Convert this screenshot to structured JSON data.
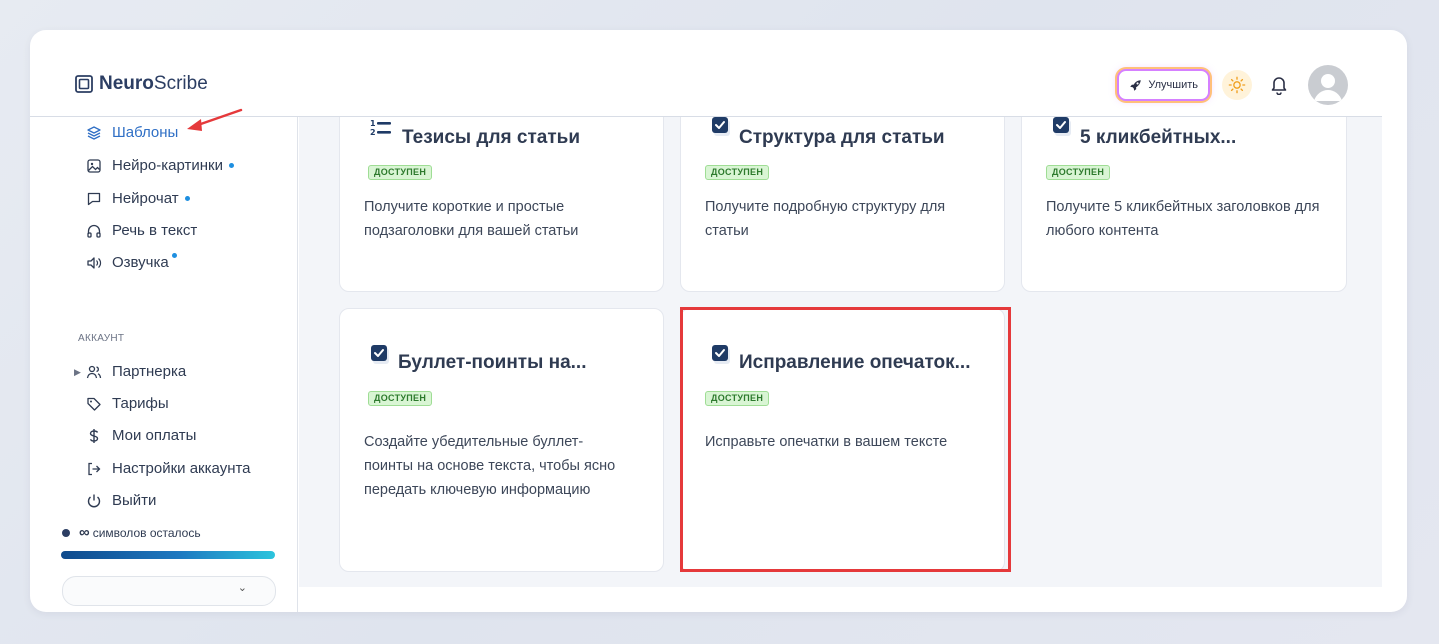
{
  "header": {
    "logo_bold": "Neuro",
    "logo_rest": "Scribe",
    "upgrade_label": "Улучшить"
  },
  "sidebar": {
    "items": [
      {
        "label": "Шаблоны",
        "icon": "layers-icon",
        "active": true
      },
      {
        "label": "Нейро-картинки",
        "icon": "image-icon",
        "dot": true
      },
      {
        "label": "Нейрочат",
        "icon": "chat-icon",
        "dot": true
      },
      {
        "label": "Речь в текст",
        "icon": "headphones-icon"
      },
      {
        "label": "Озвучка",
        "icon": "speaker-icon",
        "dot": true
      }
    ],
    "account_title": "АККАУНТ",
    "account_items": [
      {
        "label": "Партнерка",
        "icon": "users-icon"
      },
      {
        "label": "Тарифы",
        "icon": "tag-icon"
      },
      {
        "label": "Мои оплаты",
        "icon": "dollar-icon"
      },
      {
        "label": "Настройки аккаунта",
        "icon": "login-icon"
      },
      {
        "label": "Выйти",
        "icon": "power-icon"
      }
    ],
    "chars_symbol": "∞",
    "chars_label": "символов осталось"
  },
  "cards": [
    {
      "title": "Тезисы для статьи",
      "badge": "ДОСТУПЕН",
      "desc": "Получите короткие и простые подзаголовки для вашей статьи",
      "icon": "list-icon"
    },
    {
      "title": "Структура для статьи",
      "badge": "ДОСТУПЕН",
      "desc": "Получите подробную структуру для статьи",
      "icon": "checkbox-icon"
    },
    {
      "title": "5 кликбейтных...",
      "badge": "ДОСТУПЕН",
      "desc": "Получите 5 кликбейтных заголовков для любого контента",
      "icon": "checkbox-icon"
    },
    {
      "title": "Буллет-поинты на...",
      "badge": "ДОСТУПЕН",
      "desc": "Создайте убедительные буллет-поинты на основе текста, чтобы ясно передать ключевую информацию",
      "icon": "checkbox-icon"
    },
    {
      "title": "Исправление опечаток...",
      "badge": "ДОСТУПЕН",
      "desc": "Исправьте опечатки в вашем тексте",
      "icon": "checkbox-icon"
    }
  ],
  "colors": {
    "accent": "#2f6fc5",
    "badge_bg": "#d9f5d4",
    "badge_text": "#2d7a2d",
    "highlight": "#e5393b",
    "arrow": "#e5393b"
  }
}
